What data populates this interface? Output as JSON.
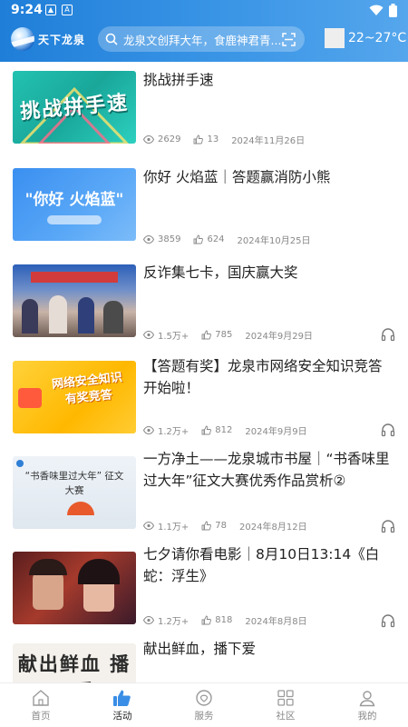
{
  "status_bar": {
    "time": "9:24"
  },
  "header": {
    "logo_text": "天下龙泉",
    "search_text": "龙泉文创拜大年，食鹿神君青...",
    "weather": "22~27°C"
  },
  "articles": [
    {
      "title": "挑战拼手速",
      "thumb_text": "挑战拼手速",
      "views": "2629",
      "likes": "13",
      "date": "2024年11月26日",
      "audio": false
    },
    {
      "title": "你好 火焰蓝｜答题赢消防小熊",
      "thumb_text": "\"你好  火焰蓝\"",
      "views": "3859",
      "likes": "624",
      "date": "2024年10月25日",
      "audio": false
    },
    {
      "title": "反诈集七卡，国庆赢大奖",
      "thumb_text": "",
      "views": "1.5万+",
      "likes": "785",
      "date": "2024年9月29日",
      "audio": true
    },
    {
      "title": "【答题有奖】龙泉市网络安全知识竞答开始啦！",
      "thumb_text": "网络安全知识 有奖竞答",
      "views": "1.2万+",
      "likes": "812",
      "date": "2024年9月9日",
      "audio": true
    },
    {
      "title": "一方净土——龙泉城市书屋｜“书香味里过大年”征文大赛优秀作品赏析②",
      "thumb_text": "“书香味里过大年” 征文大赛",
      "views": "1.1万+",
      "likes": "78",
      "date": "2024年8月12日",
      "audio": true
    },
    {
      "title": "七夕请你看电影｜8月10日13:14《白蛇：浮生》",
      "thumb_text": "",
      "views": "1.2万+",
      "likes": "818",
      "date": "2024年8月8日",
      "audio": true
    },
    {
      "title": "献出鲜血，播下爱",
      "thumb_text": "献出鲜血 播下爱",
      "views": "",
      "likes": "",
      "date": "",
      "audio": false
    }
  ],
  "nav": [
    {
      "label": "首页",
      "icon": "home-icon",
      "active": false
    },
    {
      "label": "活动",
      "icon": "thumbs-up-icon",
      "active": true
    },
    {
      "label": "服务",
      "icon": "service-icon",
      "active": false
    },
    {
      "label": "社区",
      "icon": "grid-icon",
      "active": false
    },
    {
      "label": "我的",
      "icon": "person-icon",
      "active": false
    }
  ],
  "colors": {
    "header": "#2f8ce2",
    "active_nav": "#3a8ee6"
  }
}
